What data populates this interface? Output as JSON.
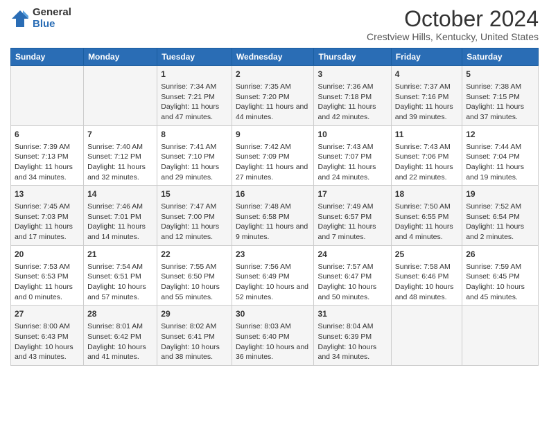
{
  "logo": {
    "general": "General",
    "blue": "Blue"
  },
  "title": "October 2024",
  "subtitle": "Crestview Hills, Kentucky, United States",
  "days_of_week": [
    "Sunday",
    "Monday",
    "Tuesday",
    "Wednesday",
    "Thursday",
    "Friday",
    "Saturday"
  ],
  "weeks": [
    [
      {
        "day": "",
        "content": ""
      },
      {
        "day": "",
        "content": ""
      },
      {
        "day": "1",
        "content": "Sunrise: 7:34 AM\nSunset: 7:21 PM\nDaylight: 11 hours and 47 minutes."
      },
      {
        "day": "2",
        "content": "Sunrise: 7:35 AM\nSunset: 7:20 PM\nDaylight: 11 hours and 44 minutes."
      },
      {
        "day": "3",
        "content": "Sunrise: 7:36 AM\nSunset: 7:18 PM\nDaylight: 11 hours and 42 minutes."
      },
      {
        "day": "4",
        "content": "Sunrise: 7:37 AM\nSunset: 7:16 PM\nDaylight: 11 hours and 39 minutes."
      },
      {
        "day": "5",
        "content": "Sunrise: 7:38 AM\nSunset: 7:15 PM\nDaylight: 11 hours and 37 minutes."
      }
    ],
    [
      {
        "day": "6",
        "content": "Sunrise: 7:39 AM\nSunset: 7:13 PM\nDaylight: 11 hours and 34 minutes."
      },
      {
        "day": "7",
        "content": "Sunrise: 7:40 AM\nSunset: 7:12 PM\nDaylight: 11 hours and 32 minutes."
      },
      {
        "day": "8",
        "content": "Sunrise: 7:41 AM\nSunset: 7:10 PM\nDaylight: 11 hours and 29 minutes."
      },
      {
        "day": "9",
        "content": "Sunrise: 7:42 AM\nSunset: 7:09 PM\nDaylight: 11 hours and 27 minutes."
      },
      {
        "day": "10",
        "content": "Sunrise: 7:43 AM\nSunset: 7:07 PM\nDaylight: 11 hours and 24 minutes."
      },
      {
        "day": "11",
        "content": "Sunrise: 7:43 AM\nSunset: 7:06 PM\nDaylight: 11 hours and 22 minutes."
      },
      {
        "day": "12",
        "content": "Sunrise: 7:44 AM\nSunset: 7:04 PM\nDaylight: 11 hours and 19 minutes."
      }
    ],
    [
      {
        "day": "13",
        "content": "Sunrise: 7:45 AM\nSunset: 7:03 PM\nDaylight: 11 hours and 17 minutes."
      },
      {
        "day": "14",
        "content": "Sunrise: 7:46 AM\nSunset: 7:01 PM\nDaylight: 11 hours and 14 minutes."
      },
      {
        "day": "15",
        "content": "Sunrise: 7:47 AM\nSunset: 7:00 PM\nDaylight: 11 hours and 12 minutes."
      },
      {
        "day": "16",
        "content": "Sunrise: 7:48 AM\nSunset: 6:58 PM\nDaylight: 11 hours and 9 minutes."
      },
      {
        "day": "17",
        "content": "Sunrise: 7:49 AM\nSunset: 6:57 PM\nDaylight: 11 hours and 7 minutes."
      },
      {
        "day": "18",
        "content": "Sunrise: 7:50 AM\nSunset: 6:55 PM\nDaylight: 11 hours and 4 minutes."
      },
      {
        "day": "19",
        "content": "Sunrise: 7:52 AM\nSunset: 6:54 PM\nDaylight: 11 hours and 2 minutes."
      }
    ],
    [
      {
        "day": "20",
        "content": "Sunrise: 7:53 AM\nSunset: 6:53 PM\nDaylight: 11 hours and 0 minutes."
      },
      {
        "day": "21",
        "content": "Sunrise: 7:54 AM\nSunset: 6:51 PM\nDaylight: 10 hours and 57 minutes."
      },
      {
        "day": "22",
        "content": "Sunrise: 7:55 AM\nSunset: 6:50 PM\nDaylight: 10 hours and 55 minutes."
      },
      {
        "day": "23",
        "content": "Sunrise: 7:56 AM\nSunset: 6:49 PM\nDaylight: 10 hours and 52 minutes."
      },
      {
        "day": "24",
        "content": "Sunrise: 7:57 AM\nSunset: 6:47 PM\nDaylight: 10 hours and 50 minutes."
      },
      {
        "day": "25",
        "content": "Sunrise: 7:58 AM\nSunset: 6:46 PM\nDaylight: 10 hours and 48 minutes."
      },
      {
        "day": "26",
        "content": "Sunrise: 7:59 AM\nSunset: 6:45 PM\nDaylight: 10 hours and 45 minutes."
      }
    ],
    [
      {
        "day": "27",
        "content": "Sunrise: 8:00 AM\nSunset: 6:43 PM\nDaylight: 10 hours and 43 minutes."
      },
      {
        "day": "28",
        "content": "Sunrise: 8:01 AM\nSunset: 6:42 PM\nDaylight: 10 hours and 41 minutes."
      },
      {
        "day": "29",
        "content": "Sunrise: 8:02 AM\nSunset: 6:41 PM\nDaylight: 10 hours and 38 minutes."
      },
      {
        "day": "30",
        "content": "Sunrise: 8:03 AM\nSunset: 6:40 PM\nDaylight: 10 hours and 36 minutes."
      },
      {
        "day": "31",
        "content": "Sunrise: 8:04 AM\nSunset: 6:39 PM\nDaylight: 10 hours and 34 minutes."
      },
      {
        "day": "",
        "content": ""
      },
      {
        "day": "",
        "content": ""
      }
    ]
  ]
}
